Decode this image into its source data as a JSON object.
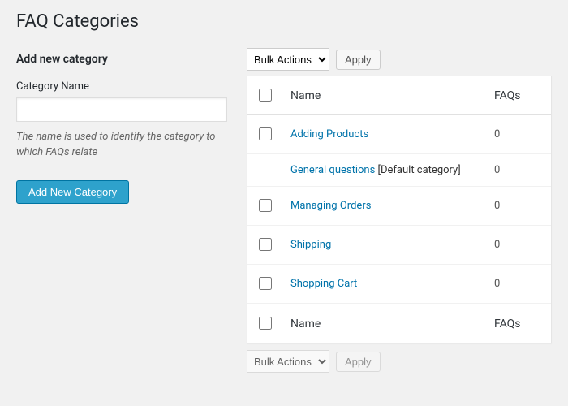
{
  "page_title": "FAQ Categories",
  "form": {
    "heading": "Add new category",
    "name_label": "Category Name",
    "name_value": "",
    "description": "The name is used to identify the category to which FAQs relate",
    "submit_label": "Add New Category"
  },
  "bulk": {
    "selected": "Bulk Actions",
    "apply_label": "Apply"
  },
  "columns": {
    "name": "Name",
    "faqs": "FAQs"
  },
  "rows": [
    {
      "name": "Adding Products",
      "default": false,
      "selectable": true,
      "faqs": "0"
    },
    {
      "name": "General questions",
      "default": true,
      "selectable": false,
      "faqs": "0"
    },
    {
      "name": "Managing Orders",
      "default": false,
      "selectable": true,
      "faqs": "0"
    },
    {
      "name": "Shipping",
      "default": false,
      "selectable": true,
      "faqs": "0"
    },
    {
      "name": "Shopping Cart",
      "default": false,
      "selectable": true,
      "faqs": "0"
    }
  ],
  "default_suffix": " [Default category]"
}
